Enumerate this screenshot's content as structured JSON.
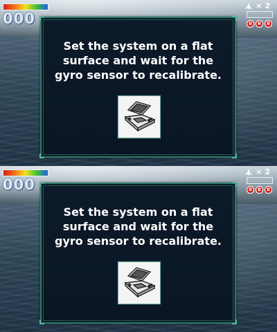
{
  "hud": {
    "score": "000",
    "lives_label": "× 2",
    "bomb_count_text": [
      "B",
      "B",
      "B"
    ]
  },
  "dialog": {
    "message": "Set the system on a flat\nsurface and wait for the\ngyro sensor to recalibrate."
  },
  "icons": {
    "lives": "arwing-ship-icon",
    "device": "handheld-console-icon",
    "bomb": "smart-bomb-icon"
  },
  "colors": {
    "dialog_border": "#2f7a6e",
    "dialog_bg": "#0d1a2a",
    "score_text": "#dfe9f5",
    "bomb": "#d0201a"
  }
}
